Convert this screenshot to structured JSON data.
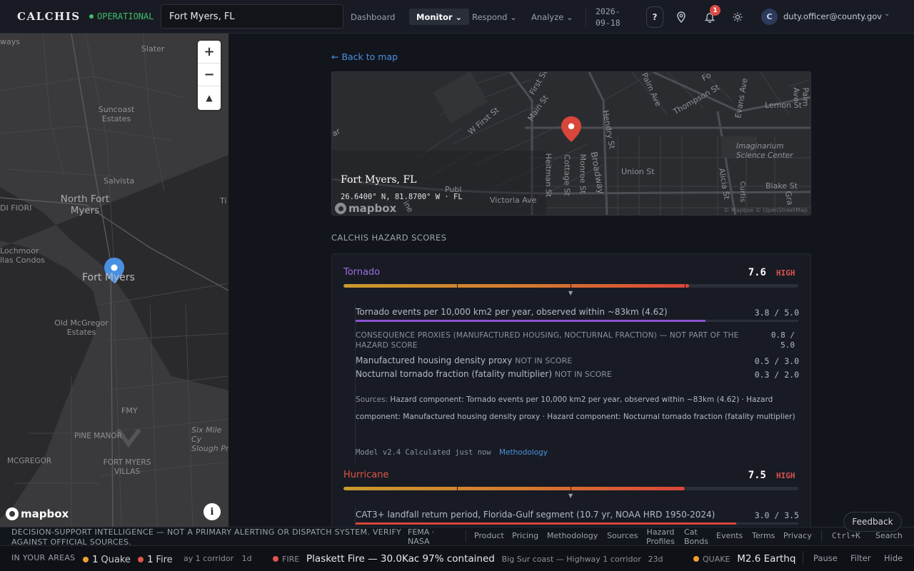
{
  "header": {
    "brand": "CALCHIS",
    "status": "OPERATIONAL",
    "search_value": "Fort Myers, FL",
    "nav": [
      {
        "label": "Dashboard"
      },
      {
        "label": "Monitor ⌄"
      },
      {
        "label": "Respond ⌄"
      },
      {
        "label": "Analyze ⌄"
      }
    ],
    "date_line1": "2026-",
    "date_line2": "09-18",
    "help_label": "?",
    "notification_count": "1",
    "avatar_initial": "C",
    "user_email": "duty.officer@county.gov",
    "user_chevron": "⌄"
  },
  "left_map": {
    "labels": {
      "ways": "ways",
      "slater": "Slater",
      "suncoast": "Suncoast\nEstates",
      "salvista": "Salvista",
      "north_fort_myers": "North Fort\nMyers",
      "di_fiori": "DI FIORI",
      "lochmoor": "Lochmoor\nllas Condos",
      "fort_myers": "Fort Myers",
      "old_mcgregor": "Old McGregor\nEstates",
      "fmy": "FMY",
      "pine_manor": "PINE MANOR",
      "six_mile": "Six Mile Cy\nSlough Pr",
      "mcgregor": "MCGREGOR",
      "fort_myers_villas": "FORT MYERS\nVILLAS",
      "ti": "Ti"
    },
    "zoom_in": "+",
    "zoom_out": "−",
    "compass": "▲",
    "logo": "mapbox",
    "info": "i"
  },
  "detail": {
    "back_link": "← Back to map",
    "minimap": {
      "location_title": "Fort Myers, FL",
      "coords": "26.6400° N, 81.8700° W · FL",
      "logo": "mapbox",
      "attribution": "© Mapbox © OpenStreetMap",
      "streets": {
        "first": "First St",
        "w_first": "W First St",
        "main": "Main St",
        "palm": "Palm Ave",
        "thompson": "Thompson St",
        "evans": "Evans Ave",
        "lemon": "Lemon St",
        "palmave2": "Palm Ave",
        "hendry": "Hendry St",
        "heitman": "Heitman St",
        "cottage": "Cottage St",
        "monroe": "Monroe St",
        "broadway": "Broadway",
        "union": "Union St",
        "alicia": "Alicia St",
        "curtis": "Curtis",
        "blake": "Blake St",
        "gra": "Gra",
        "victoria": "Victoria Ave",
        "imaginarium": "Imaginarium\nScience Center",
        "publ": "Publ",
        "fo": "Fo",
        "ar": "ar",
        "ine": "ine"
      }
    },
    "section_title": "CALCHIS HAZARD SCORES",
    "hazards": [
      {
        "name": "Tornado",
        "name_color": "#9b6fe0",
        "score": "7.6",
        "level": "HIGH",
        "fill_pct": 76,
        "components": [
          {
            "label": "Tornado events per 10,000 km2 per year, observed within ~83km (4.62)",
            "value": "3.8 / 5.0",
            "fill_pct": 79
          }
        ],
        "consequence_header": "CONSEQUENCE PROXIES (MANUFACTURED HOUSING, NOCTURNAL FRACTION) — NOT PART OF THE HAZARD SCORE",
        "consequence_value": "0.8 / 5.0",
        "proxies": [
          {
            "label": "Manufactured housing density proxy",
            "tag": "NOT IN SCORE",
            "value": "0.5 / 3.0"
          },
          {
            "label": "Nocturnal tornado fraction (fatality multiplier)",
            "tag": "NOT IN SCORE",
            "value": "0.3 / 2.0"
          }
        ],
        "sources_label": "Sources:",
        "sources_text": "Hazard component: Tornado events per 10,000 km2 per year, observed within ~83km (4.62) · Hazard component: Manufactured housing density proxy · Hazard component: Nocturnal tornado fraction (fatality multiplier)",
        "model": "Model v2.4",
        "calculated": "Calculated just now",
        "methodology_link": "Methodology"
      },
      {
        "name": "Hurricane",
        "name_color": "#e0564a",
        "score": "7.5",
        "level": "HIGH",
        "fill_pct": 75,
        "components": [
          {
            "label": "CAT3+ landfall return period, Florida-Gulf segment (10.7 yr, NOAA HRD 1950-2024)",
            "value": "3.0 / 3.5",
            "fill_pct": 86
          }
        ]
      }
    ]
  },
  "footer": {
    "disclaimer": "DECISION-SUPPORT INTELLIGENCE — NOT A PRIMARY ALERTING OR DISPATCH SYSTEM. VERIFY AGAINST OFFICIAL SOURCES.",
    "agencies": "FEMA ·\nNASA",
    "links": [
      "Product",
      "Pricing",
      "Methodology",
      "Sources",
      "Hazard\nProfiles",
      "Cat\nBonds",
      "Events",
      "Terms",
      "Privacy"
    ],
    "shortcut": "Ctrl+K",
    "search": "Search",
    "feedback": "Feedback"
  },
  "ticker": {
    "label": "IN YOUR AREAS",
    "quake_count": "1",
    "quake_label": "Quake",
    "fire_count": "1",
    "fire_label": "Fire",
    "fragment": "ay 1 corridor",
    "fragment_age": "1d",
    "fire_kind": "FIRE",
    "fire_title": "Plaskett Fire — 30.0Kac 97% contained",
    "fire_loc": "Big Sur coast — Highway 1 corridor",
    "fire_age": "23d",
    "quake_kind": "QUAKE",
    "quake_title": "M2.6 Earthq",
    "pause": "Pause",
    "filter": "Filter",
    "hide": "Hide",
    "colors": {
      "quake": "#f0a030",
      "fire": "#e0564a"
    }
  }
}
